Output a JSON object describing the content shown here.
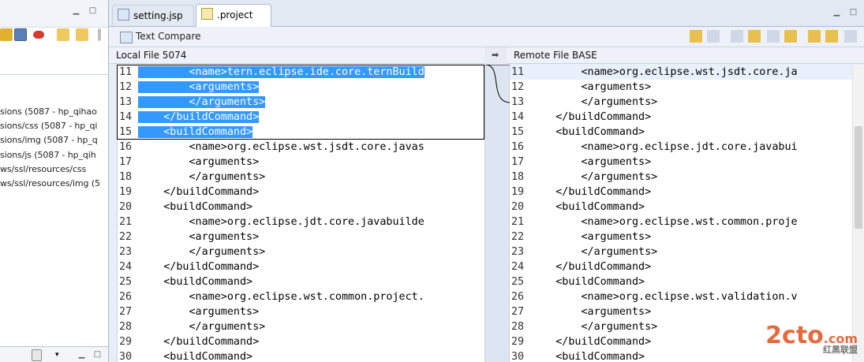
{
  "left_panel": {
    "tree_items": [
      "sions (5087 - hp_qihao",
      "sions/css (5087 - hp_qi",
      "sions/img (5087 - hp_q",
      "sions/js (5087 - hp_qih",
      "ws/ssl/resources/css",
      "ws/ssl/resources/img (5"
    ]
  },
  "tabs": [
    {
      "label": "setting.jsp",
      "active": false
    },
    {
      "label": ".project",
      "active": true,
      "close": "✕"
    }
  ],
  "compare": {
    "title": "Text Compare",
    "left_header": "Local File 5074",
    "right_header": "Remote File BASE",
    "center_arrow": "➡"
  },
  "left_lines": [
    {
      "n": "11",
      "text": "        <name>tern.eclipse.ide.core.ternBuild",
      "selected": true
    },
    {
      "n": "12",
      "text": "        <arguments>",
      "selected": true
    },
    {
      "n": "13",
      "text": "        </arguments>",
      "selected": true
    },
    {
      "n": "14",
      "text": "    </buildCommand>",
      "selected": true
    },
    {
      "n": "15",
      "text": "    <buildCommand>",
      "selected": true
    },
    {
      "n": "16",
      "text": "        <name>org.eclipse.wst.jsdt.core.javas"
    },
    {
      "n": "17",
      "text": "        <arguments>"
    },
    {
      "n": "18",
      "text": "        </arguments>"
    },
    {
      "n": "19",
      "text": "    </buildCommand>"
    },
    {
      "n": "20",
      "text": "    <buildCommand>"
    },
    {
      "n": "21",
      "text": "        <name>org.eclipse.jdt.core.javabuilde"
    },
    {
      "n": "22",
      "text": "        <arguments>"
    },
    {
      "n": "23",
      "text": "        </arguments>"
    },
    {
      "n": "24",
      "text": "    </buildCommand>"
    },
    {
      "n": "25",
      "text": "    <buildCommand>"
    },
    {
      "n": "26",
      "text": "        <name>org.eclipse.wst.common.project."
    },
    {
      "n": "27",
      "text": "        <arguments>"
    },
    {
      "n": "28",
      "text": "        </arguments>"
    },
    {
      "n": "29",
      "text": "    </buildCommand>"
    },
    {
      "n": "30",
      "text": "    <buildCommand>"
    }
  ],
  "right_lines": [
    {
      "n": "11",
      "text": "        <name>org.eclipse.wst.jsdt.core.ja"
    },
    {
      "n": "12",
      "text": "        <arguments>"
    },
    {
      "n": "13",
      "text": "        </arguments>"
    },
    {
      "n": "14",
      "text": "    </buildCommand>"
    },
    {
      "n": "15",
      "text": "    <buildCommand>"
    },
    {
      "n": "16",
      "text": "        <name>org.eclipse.jdt.core.javabui"
    },
    {
      "n": "17",
      "text": "        <arguments>"
    },
    {
      "n": "18",
      "text": "        </arguments>"
    },
    {
      "n": "19",
      "text": "    </buildCommand>"
    },
    {
      "n": "20",
      "text": "    <buildCommand>"
    },
    {
      "n": "21",
      "text": "        <name>org.eclipse.wst.common.proje"
    },
    {
      "n": "22",
      "text": "        <arguments>"
    },
    {
      "n": "23",
      "text": "        </arguments>"
    },
    {
      "n": "24",
      "text": "    </buildCommand>"
    },
    {
      "n": "25",
      "text": "    <buildCommand>"
    },
    {
      "n": "26",
      "text": "        <name>org.eclipse.wst.validation.v"
    },
    {
      "n": "27",
      "text": "        <arguments>"
    },
    {
      "n": "28",
      "text": "        </arguments>"
    },
    {
      "n": "29",
      "text": "    </buildCommand>"
    },
    {
      "n": "30",
      "text": "    <buildCommand>"
    }
  ],
  "watermark": {
    "main": "2cto",
    "suffix": ".com",
    "sub": "红黑联盟"
  },
  "colors": {
    "selection": "#3399ff",
    "accent": "#e55a2a"
  }
}
